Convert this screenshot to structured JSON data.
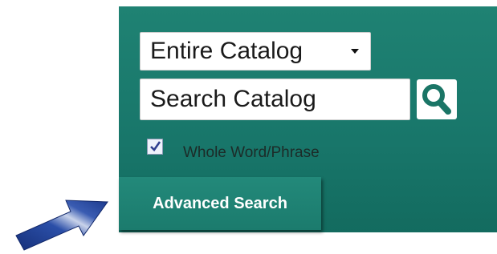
{
  "scope_select": {
    "selected": "Entire Catalog"
  },
  "search": {
    "value": "Search Catalog",
    "button_icon": "search-icon"
  },
  "whole_word": {
    "label": "Whole Word/Phrase",
    "checked": true
  },
  "advanced_search": {
    "label": "Advanced Search"
  },
  "pointer": {
    "icon": "arrow-pointer-icon"
  },
  "colors": {
    "panel": "#1a7a6c",
    "button": "#1f8374",
    "arrow": "#1e3f8f",
    "search_icon": "#1a7566"
  }
}
